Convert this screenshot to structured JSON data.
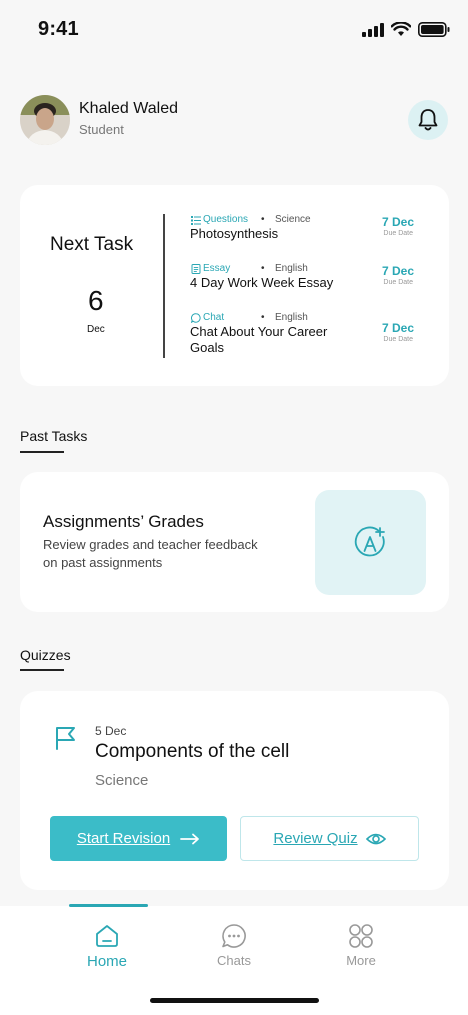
{
  "status_bar": {
    "time": "9:41"
  },
  "user": {
    "name": "Khaled Waled",
    "role": "Student"
  },
  "next_task": {
    "title": "Next Task",
    "day": "6",
    "month": "Dec",
    "items": [
      {
        "type": "Questions",
        "subject": "Science",
        "title": "Photosynthesis",
        "date": "7 Dec",
        "due": "Due Date"
      },
      {
        "type": "Essay",
        "subject": "English",
        "title": "4 Day Work Week Essay",
        "date": "7 Dec",
        "due": "Due Date"
      },
      {
        "type": "Chat",
        "subject": "English",
        "title": "Chat About Your Career Goals",
        "date": "7 Dec",
        "due": "Due Date"
      }
    ]
  },
  "past_tasks": {
    "label": "Past Tasks",
    "card_title": "Assignments’ Grades",
    "card_desc": "Review grades and teacher feedback on past assignments"
  },
  "quizzes": {
    "label": "Quizzes",
    "date": "5 Dec",
    "title": "Components of the cell",
    "subject": "Science",
    "start_label": "Start Revision",
    "review_label": "Review Quiz"
  },
  "nav": {
    "items": [
      {
        "label": "Home",
        "active": true
      },
      {
        "label": "Chats",
        "active": false
      },
      {
        "label": "More",
        "active": false
      }
    ]
  },
  "colors": {
    "accent": "#2aa7b4",
    "button": "#3bbcc8",
    "tint": "#e1f3f5"
  }
}
